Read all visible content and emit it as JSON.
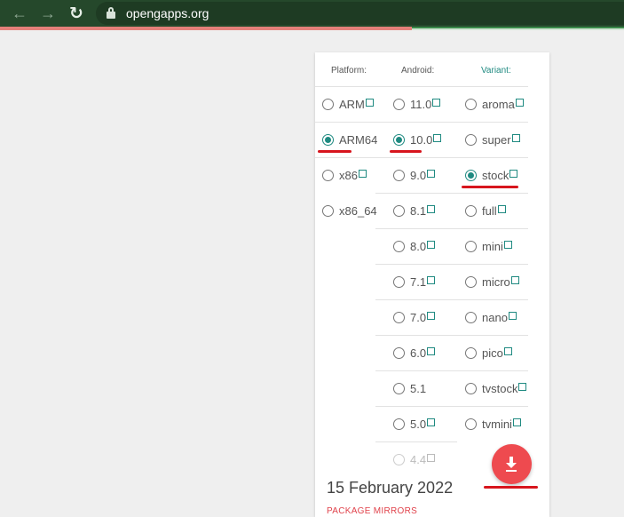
{
  "browser": {
    "url": "opengapps.org",
    "back_icon": "arrow-left-icon",
    "forward_icon": "arrow-right-icon",
    "reload_icon": "reload-icon",
    "page_load_progress": 0.66,
    "colors": {
      "frame": "#25482b",
      "progress": "#e4807a"
    }
  },
  "selector": {
    "headers": {
      "platform": "Platform:",
      "android": "Android:",
      "variant": "Variant:"
    },
    "platforms": [
      {
        "label": "ARM",
        "selected": false,
        "ext": true
      },
      {
        "label": "ARM64",
        "selected": true,
        "ext": false
      },
      {
        "label": "x86",
        "selected": false,
        "ext": true
      },
      {
        "label": "x86_64",
        "selected": false,
        "ext": false
      }
    ],
    "android_versions": [
      {
        "label": "11.0",
        "selected": false,
        "ext": true
      },
      {
        "label": "10.0",
        "selected": true,
        "ext": true
      },
      {
        "label": "9.0",
        "selected": false,
        "ext": true
      },
      {
        "label": "8.1",
        "selected": false,
        "ext": true
      },
      {
        "label": "8.0",
        "selected": false,
        "ext": true
      },
      {
        "label": "7.1",
        "selected": false,
        "ext": true
      },
      {
        "label": "7.0",
        "selected": false,
        "ext": true
      },
      {
        "label": "6.0",
        "selected": false,
        "ext": true
      },
      {
        "label": "5.1",
        "selected": false,
        "ext": false
      },
      {
        "label": "5.0",
        "selected": false,
        "ext": true
      },
      {
        "label": "4.4",
        "selected": false,
        "ext": true,
        "disabled": true
      }
    ],
    "variants": [
      {
        "label": "aroma",
        "selected": false,
        "ext": true
      },
      {
        "label": "super",
        "selected": false,
        "ext": true
      },
      {
        "label": "stock",
        "selected": true,
        "ext": true
      },
      {
        "label": "full",
        "selected": false,
        "ext": true
      },
      {
        "label": "mini",
        "selected": false,
        "ext": true
      },
      {
        "label": "micro",
        "selected": false,
        "ext": true
      },
      {
        "label": "nano",
        "selected": false,
        "ext": true
      },
      {
        "label": "pico",
        "selected": false,
        "ext": true
      },
      {
        "label": "tvstock",
        "selected": false,
        "ext": true
      },
      {
        "label": "tvmini",
        "selected": false,
        "ext": true
      }
    ],
    "accent_color": "#1f8a81"
  },
  "release": {
    "date": "15 February 2022",
    "mirrors_label": "PACKAGE MIRRORS"
  },
  "download_button": {
    "icon": "download-icon",
    "color": "#ee4a4f"
  },
  "annotation_color": "#d7151d"
}
